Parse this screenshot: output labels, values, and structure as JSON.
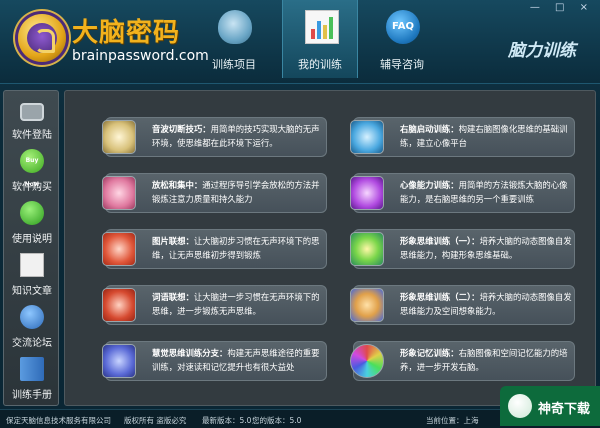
{
  "header": {
    "app_name": "大脑密码",
    "app_url": "brainpassword.com",
    "brand_right": "脑力训练",
    "window_controls": "— □ ×",
    "nav": [
      {
        "label": "训练项目",
        "icon": "brain-icon"
      },
      {
        "label": "我的训练",
        "icon": "chart-icon",
        "active": true
      },
      {
        "label": "辅导咨询",
        "icon": "faq-icon",
        "icon_text": "FAQ"
      }
    ]
  },
  "sidebar": {
    "items": [
      {
        "label": "软件登陆",
        "icon": "lock-icon"
      },
      {
        "label": "软件购买",
        "icon": "buy-now-icon",
        "icon_text": "Buy Now"
      },
      {
        "label": "使用说明",
        "icon": "help-icon"
      },
      {
        "label": "知识文章",
        "icon": "document-icon"
      },
      {
        "label": "交流论坛",
        "icon": "users-icon"
      },
      {
        "label": "训练手册",
        "icon": "book-icon"
      }
    ]
  },
  "cards": [
    {
      "title": "音波切断技巧：",
      "text": "用简单的技巧实现大脑的无声环境，使思维都在此环境下运行。"
    },
    {
      "title": "右脑启动训练：",
      "text": "构建右脑图像化思维的基础训练，建立心像平台"
    },
    {
      "title": "放松和集中：",
      "text": "通过程序导引学会放松的方法并锻炼注意力质量和持久能力"
    },
    {
      "title": "心像能力训练：",
      "text": "用简单的方法锻炼大脑的心像能力，是右脑思维的另一个重要训练"
    },
    {
      "title": "图片联想：",
      "text": "让大脑初步习惯在无声环境下的思维，让无声思维初步得到锻炼"
    },
    {
      "title": "形象思维训练（一）：",
      "text": "培养大脑的动态图像自发思维能力，构建形象思维基础。"
    },
    {
      "title": "词语联想：",
      "text": "让大脑进一步习惯在无声环境下的思维，进一步锻炼无声思维。"
    },
    {
      "title": "形象思维训练（二）：",
      "text": "培养大脑的动态图像自发思维能力及空间想象能力。"
    },
    {
      "title": "慧觉思维训练分支：",
      "text": "构建无声思维途径的重要训练，对速读和记忆提升也有很大益处"
    },
    {
      "title": "形象记忆训练：",
      "text": "右脑图像和空间记忆能力的培养，进一步开发右脑。"
    }
  ],
  "status": {
    "company": "保定天脑信息技术服务有限公司",
    "rights": "版权所有 盗版必究",
    "latest_version": "最新版本：5.0",
    "your_version": "您的版本：5.0",
    "location": "当前位置：上海"
  },
  "watermark": {
    "text": "神奇下载"
  }
}
